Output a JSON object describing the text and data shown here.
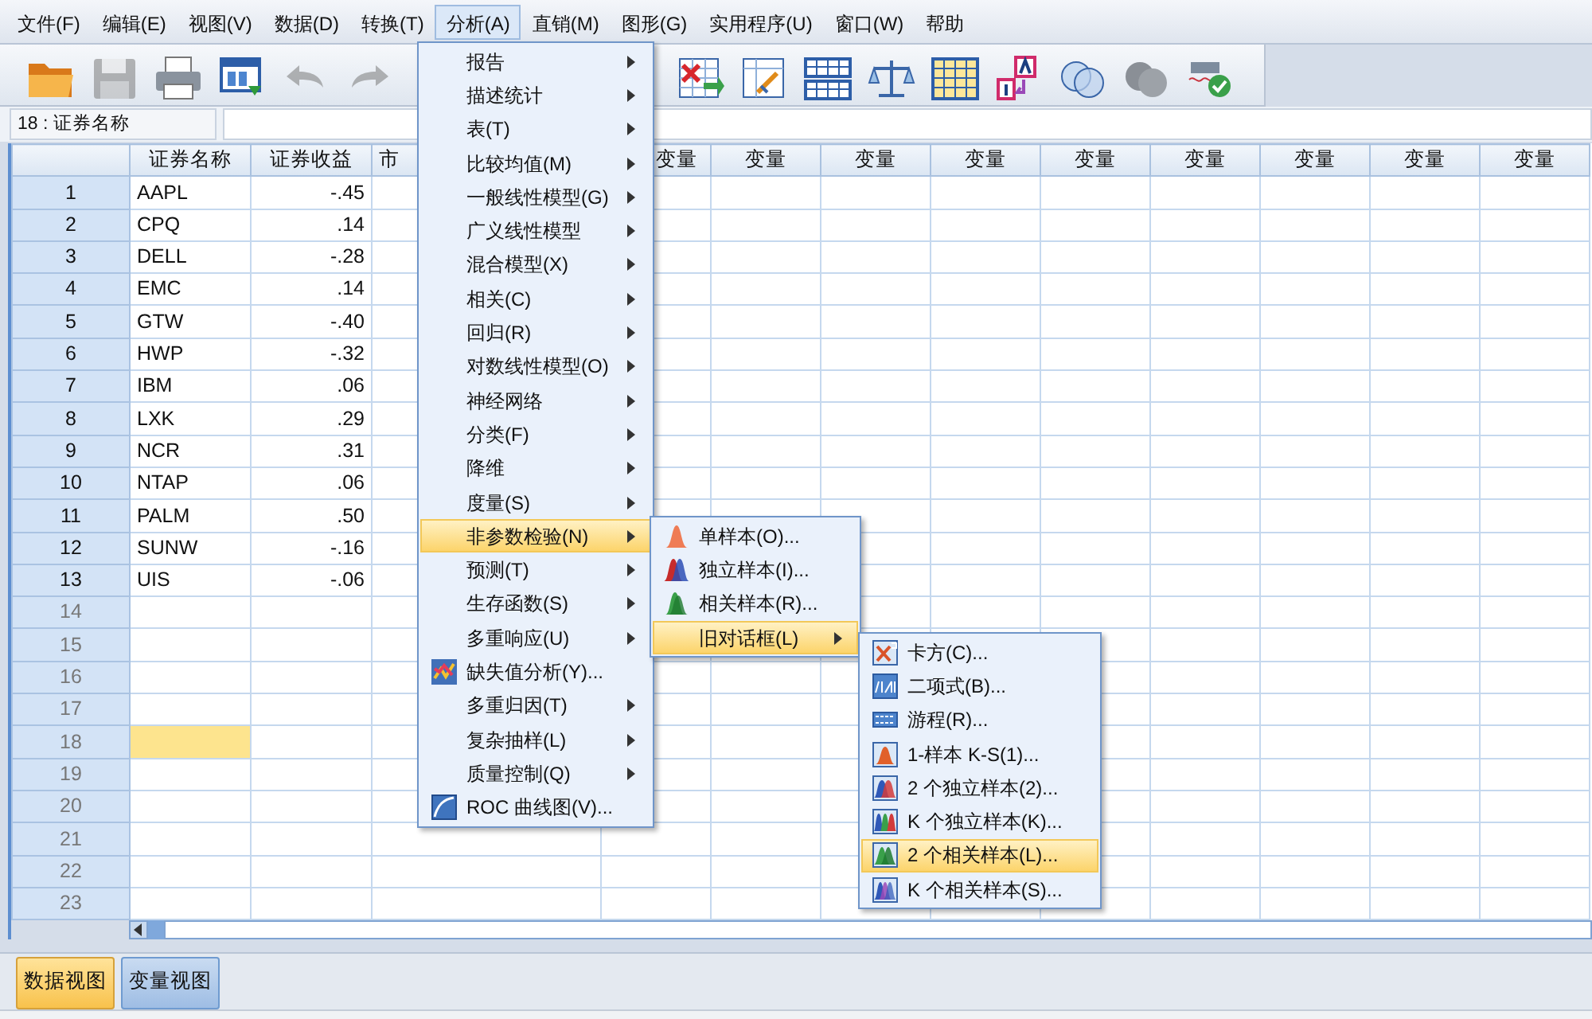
{
  "menubar": [
    {
      "label": "文件(F)",
      "selected": false
    },
    {
      "label": "编辑(E)",
      "selected": false
    },
    {
      "label": "视图(V)",
      "selected": false
    },
    {
      "label": "数据(D)",
      "selected": false
    },
    {
      "label": "转换(T)",
      "selected": false
    },
    {
      "label": "分析(A)",
      "selected": true
    },
    {
      "label": "直销(M)",
      "selected": false
    },
    {
      "label": "图形(G)",
      "selected": false
    },
    {
      "label": "实用程序(U)",
      "selected": false
    },
    {
      "label": "窗口(W)",
      "selected": false
    },
    {
      "label": "帮助",
      "selected": false
    }
  ],
  "toolbar": [
    {
      "kind": "open",
      "disabled": false
    },
    {
      "kind": "save",
      "disabled": true
    },
    {
      "kind": "print",
      "disabled": false
    },
    {
      "kind": "recall",
      "disabled": false
    },
    {
      "kind": "undo",
      "disabled": true
    },
    {
      "kind": "redo",
      "disabled": true
    },
    {
      "kind": "delete",
      "disabled": false
    },
    {
      "kind": "chart",
      "disabled": false
    },
    {
      "kind": "split",
      "disabled": false
    },
    {
      "kind": "weight",
      "disabled": false
    },
    {
      "kind": "select",
      "disabled": false
    },
    {
      "kind": "labels",
      "disabled": false
    },
    {
      "kind": "sets",
      "disabled": false
    },
    {
      "kind": "setsoff",
      "disabled": false
    },
    {
      "kind": "spell",
      "disabled": false
    }
  ],
  "cell_reference": "18 : 证券名称",
  "grid": {
    "columns": [
      "证券名称",
      "证券收益",
      "市",
      "变量",
      "变量",
      "变量",
      "变量",
      "变量",
      "变量",
      "变量",
      "变量",
      "变量"
    ],
    "rows": [
      {
        "number": "1",
        "cells": [
          "AAPL",
          "-.45"
        ],
        "selected": false
      },
      {
        "number": "2",
        "cells": [
          "CPQ",
          ".14"
        ],
        "selected": false
      },
      {
        "number": "3",
        "cells": [
          "DELL",
          "-.28"
        ],
        "selected": false
      },
      {
        "number": "4",
        "cells": [
          "EMC",
          ".14"
        ],
        "selected": false
      },
      {
        "number": "5",
        "cells": [
          "GTW",
          "-.40"
        ],
        "selected": false
      },
      {
        "number": "6",
        "cells": [
          "HWP",
          "-.32"
        ],
        "selected": false
      },
      {
        "number": "7",
        "cells": [
          "IBM",
          ".06"
        ],
        "selected": false
      },
      {
        "number": "8",
        "cells": [
          "LXK",
          ".29"
        ],
        "selected": false
      },
      {
        "number": "9",
        "cells": [
          "NCR",
          ".31"
        ],
        "selected": false
      },
      {
        "number": "10",
        "cells": [
          "NTAP",
          ".06"
        ],
        "selected": false
      },
      {
        "number": "11",
        "cells": [
          "PALM",
          ".50"
        ],
        "selected": false
      },
      {
        "number": "12",
        "cells": [
          "SUNW",
          "-.16"
        ],
        "selected": false
      },
      {
        "number": "13",
        "cells": [
          "UIS",
          "-.06"
        ],
        "selected": false
      },
      {
        "number": "14",
        "cells": [],
        "selected": false
      },
      {
        "number": "15",
        "cells": [],
        "selected": false
      },
      {
        "number": "16",
        "cells": [],
        "selected": false
      },
      {
        "number": "17",
        "cells": [],
        "selected": false
      },
      {
        "number": "18",
        "cells": [],
        "selected": true
      },
      {
        "number": "19",
        "cells": [],
        "selected": false
      },
      {
        "number": "20",
        "cells": [],
        "selected": false
      },
      {
        "number": "21",
        "cells": [],
        "selected": false
      },
      {
        "number": "22",
        "cells": [],
        "selected": false
      },
      {
        "number": "23",
        "cells": [],
        "selected": false
      }
    ]
  },
  "analyze_menu": [
    {
      "label": "报告",
      "submenu": true,
      "selected": false
    },
    {
      "label": "描述统计",
      "submenu": true,
      "selected": false
    },
    {
      "label": "表(T)",
      "submenu": true,
      "selected": false
    },
    {
      "label": "比较均值(M)",
      "submenu": true,
      "selected": false
    },
    {
      "label": "一般线性模型(G)",
      "submenu": true,
      "selected": false
    },
    {
      "label": "广义线性模型",
      "submenu": true,
      "selected": false
    },
    {
      "label": "混合模型(X)",
      "submenu": true,
      "selected": false
    },
    {
      "label": "相关(C)",
      "submenu": true,
      "selected": false
    },
    {
      "label": "回归(R)",
      "submenu": true,
      "selected": false
    },
    {
      "label": "对数线性模型(O)",
      "submenu": true,
      "selected": false
    },
    {
      "label": "神经网络",
      "submenu": true,
      "selected": false
    },
    {
      "label": "分类(F)",
      "submenu": true,
      "selected": false
    },
    {
      "label": "降维",
      "submenu": true,
      "selected": false
    },
    {
      "label": "度量(S)",
      "submenu": true,
      "selected": false
    },
    {
      "label": "非参数检验(N)",
      "submenu": true,
      "selected": true
    },
    {
      "label": "预测(T)",
      "submenu": true,
      "selected": false
    },
    {
      "label": "生存函数(S)",
      "submenu": true,
      "selected": false
    },
    {
      "label": "多重响应(U)",
      "submenu": true,
      "selected": false
    },
    {
      "label": "缺失值分析(Y)...",
      "submenu": false,
      "kind": "missing",
      "selected": false
    },
    {
      "label": "多重归因(T)",
      "submenu": true,
      "selected": false
    },
    {
      "label": "复杂抽样(L)",
      "submenu": true,
      "selected": false
    },
    {
      "label": "质量控制(Q)",
      "submenu": true,
      "selected": false
    },
    {
      "label": "ROC 曲线图(V)...",
      "submenu": false,
      "kind": "roc",
      "selected": false
    }
  ],
  "nonparametric_menu": [
    {
      "label": "单样本(O)...",
      "kind": "one",
      "submenu": false,
      "selected": false
    },
    {
      "label": "独立样本(I)...",
      "kind": "independent",
      "submenu": false,
      "selected": false
    },
    {
      "label": "相关样本(R)...",
      "kind": "related",
      "submenu": false,
      "selected": false
    },
    {
      "label": "旧对话框(L)",
      "submenu": true,
      "selected": true
    }
  ],
  "legacy_dialogs_menu": [
    {
      "label": "卡方(C)...",
      "kind": "chi",
      "selected": false
    },
    {
      "label": "二项式(B)...",
      "kind": "binomial",
      "selected": false
    },
    {
      "label": "游程(R)...",
      "kind": "runs",
      "selected": false
    },
    {
      "label": "1-样本 K-S(1)...",
      "kind": "ks",
      "selected": false
    },
    {
      "label": "2 个独立样本(2)...",
      "kind": "indep2",
      "selected": false
    },
    {
      "label": "K 个独立样本(K)...",
      "kind": "indepk",
      "selected": false
    },
    {
      "label": "2 个相关样本(L)...",
      "kind": "rel2",
      "selected": true
    },
    {
      "label": "K 个相关样本(S)...",
      "kind": "relk",
      "selected": false
    }
  ],
  "view_tabs": [
    {
      "label": "数据视图",
      "selected": true
    },
    {
      "label": "变量视图",
      "selected": false
    }
  ]
}
